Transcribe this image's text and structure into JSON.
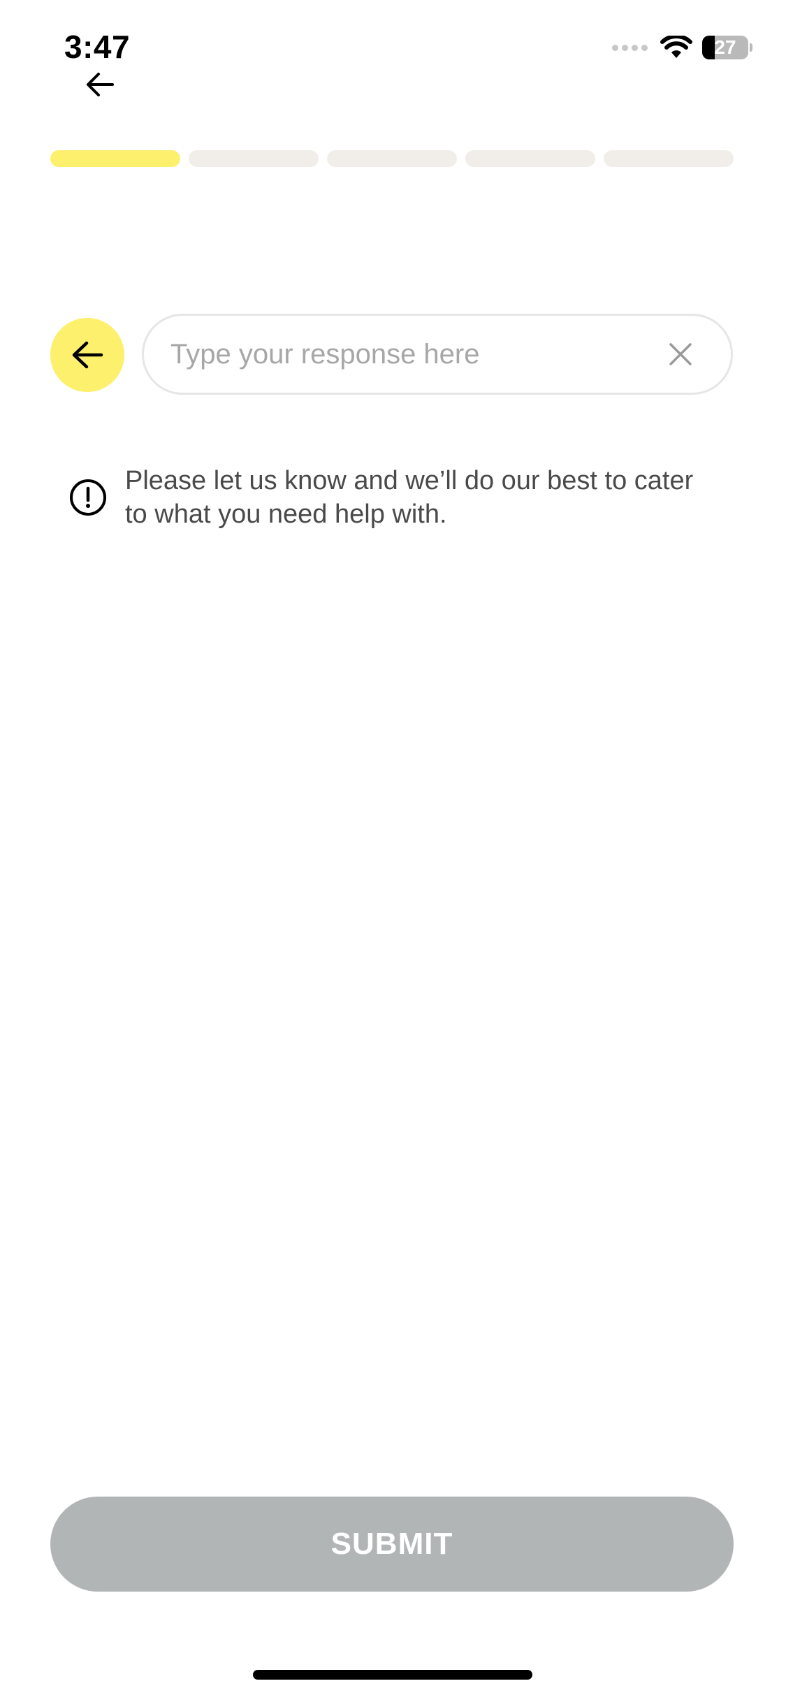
{
  "status_bar": {
    "time": "3:47",
    "battery_percent": "27",
    "battery_level": 0.27
  },
  "progress": {
    "total_steps": 5,
    "current_step": 1,
    "active_color": "#fcf06c",
    "inactive_color": "#f1eeea"
  },
  "input": {
    "placeholder": "Type your response here",
    "value": ""
  },
  "info": {
    "text": "Please let us know and we’ll do our best to cater to what you need help with."
  },
  "submit": {
    "label": "SUBMIT",
    "disabled": true
  },
  "icons": {
    "top_back": "arrow-left-icon",
    "circle_back": "arrow-left-icon",
    "clear": "close-icon",
    "info": "exclamation-circle-icon",
    "wifi": "wifi-icon"
  },
  "colors": {
    "accent": "#fcf06c",
    "submit_disabled": "#b2b5b6"
  }
}
